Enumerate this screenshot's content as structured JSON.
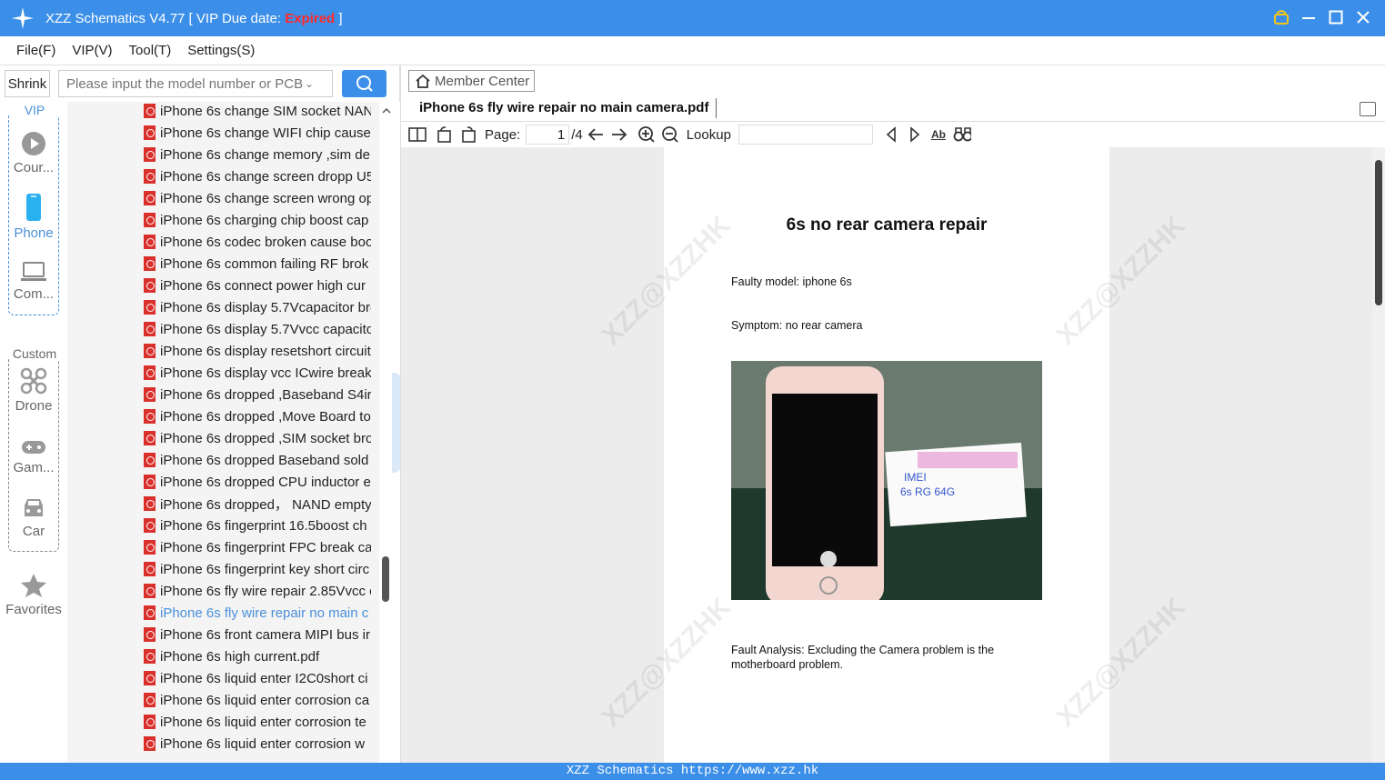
{
  "app": {
    "title_prefix": "XZZ Schematics V4.77 [ VIP Due date: ",
    "title_status": "Expired",
    "title_suffix": " ]"
  },
  "menu": [
    "File(F)",
    "VIP(V)",
    "Tool(T)",
    "Settings(S)"
  ],
  "search": {
    "shrink_label": "Shrink",
    "placeholder": "Please input the model number or PCB"
  },
  "sidebar": {
    "vip_label": "VIP",
    "custom_label": "Custom",
    "items": [
      {
        "label": "Cour...",
        "icon": "play-icon"
      },
      {
        "label": "Phone",
        "icon": "phone-icon"
      },
      {
        "label": "Com...",
        "icon": "laptop-icon"
      },
      {
        "label": "Drone",
        "icon": "drone-icon"
      },
      {
        "label": "Gam...",
        "icon": "gamepad-icon"
      },
      {
        "label": "Car",
        "icon": "car-icon"
      },
      {
        "label": "Favorites",
        "icon": "star-icon"
      }
    ]
  },
  "files": [
    "iPhone 6s change SIM socket NAN",
    "iPhone 6s change WIFI chip cause",
    "iPhone 6s change memory ,sim de",
    "iPhone 6s change screen dropp U5",
    "iPhone 6s change screen wrong op",
    "iPhone 6s charging chip boost cap",
    "iPhone 6s codec broken cause boo",
    "iPhone 6s common failing RF brok",
    "iPhone 6s connect power high cur",
    "iPhone 6s display 5.7Vcapacitor bre",
    "iPhone 6s display 5.7Vvcc capacito",
    "iPhone 6s display resetshort circuit",
    "iPhone 6s display vcc ICwire break",
    "iPhone 6s dropped ,Baseband S4ir",
    "iPhone 6s dropped ,Move Board to",
    "iPhone 6s dropped ,SIM socket bro",
    "iPhone 6s dropped Baseband sold",
    "iPhone 6s dropped CPU inductor e",
    "iPhone 6s dropped， NAND empty",
    "iPhone 6s fingerprint 16.5boost ch",
    "iPhone 6s fingerprint FPC break ca",
    "iPhone 6s fingerprint key short circ",
    "iPhone 6s fly wire repair 2.85Vvcc c",
    "iPhone 6s fly wire repair no main c",
    "iPhone 6s front camera MIPI bus ir",
    "iPhone 6s high current.pdf",
    "iPhone 6s liquid enter I2C0short ci",
    "iPhone 6s liquid enter corrosion ca",
    "iPhone 6s liquid enter corrosion te",
    "iPhone 6s liquid enter corrosion w"
  ],
  "selected_index": 23,
  "viewer": {
    "member_center": "Member Center",
    "tab_title": "iPhone 6s fly wire repair no main camera.pdf",
    "page_label": "Page:",
    "page_current": "1",
    "page_total": "/4",
    "lookup_label": "Lookup"
  },
  "pdf": {
    "title": "6s no rear camera repair",
    "faulty_model": "Faulty model: iphone 6s",
    "symptom": "Symptom: no rear camera",
    "analysis_1": "Fault Analysis: Excluding the Camera problem is the",
    "analysis_2": "motherboard problem.",
    "watermark": "XZZ@XZZHK"
  },
  "status": "XZZ Schematics https://www.xzz.hk",
  "colors": {
    "accent": "#3c8fe8",
    "expired": "#ff2a2a",
    "pdf_icon": "#d9302c"
  }
}
